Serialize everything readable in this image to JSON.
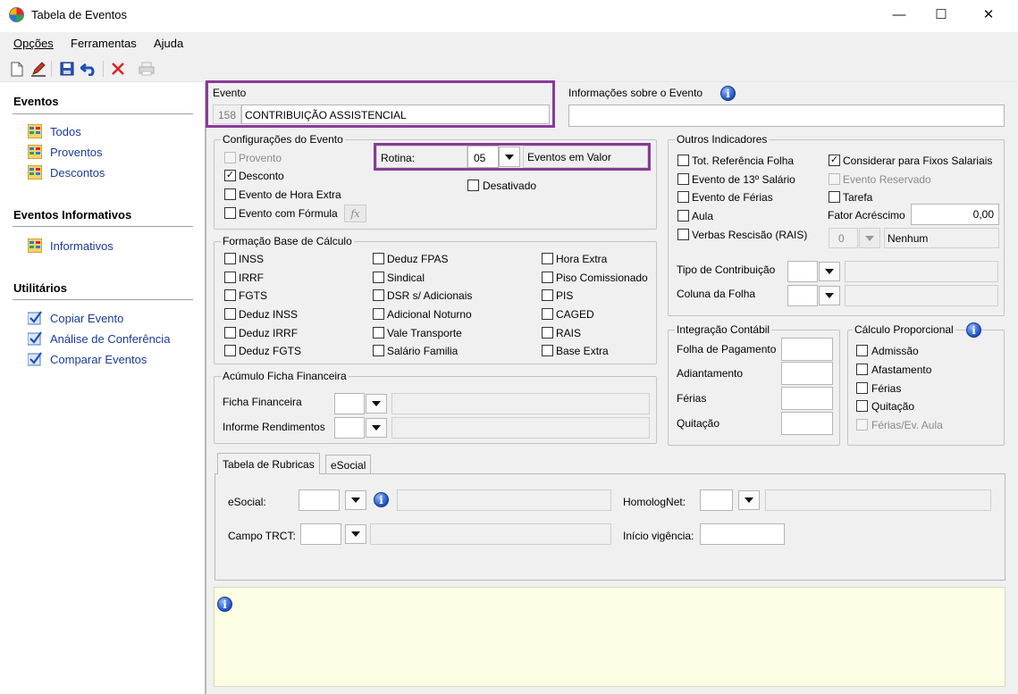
{
  "window": {
    "title": "Tabela de Eventos",
    "minimize": "—",
    "maximize": "☐",
    "close": "✕"
  },
  "menu": [
    "Opções",
    "Ferramentas",
    "Ajuda"
  ],
  "sidebar": {
    "eventos_title": "Eventos",
    "eventos": [
      "Todos",
      "Proventos",
      "Descontos"
    ],
    "informativos_title": "Eventos Informativos",
    "informativos": [
      "Informativos"
    ],
    "utilitarios_title": "Utilitários",
    "utilitarios": [
      "Copiar Evento",
      "Análise de Conferência",
      "Comparar Eventos"
    ]
  },
  "evento": {
    "label": "Evento",
    "code": "158",
    "name": "CONTRIBUIÇÃO ASSISTENCIAL"
  },
  "info_evento": {
    "label": "Informações sobre o Evento",
    "value": ""
  },
  "config": {
    "legend": "Configurações do Evento",
    "provento": "Provento",
    "desconto": "Desconto",
    "hora_extra": "Evento de Hora Extra",
    "formula": "Evento com Fórmula",
    "formula_btn": "fx",
    "rotina_label": "Rotina:",
    "rotina_value": "05",
    "rotina_desc": "Eventos em Valor",
    "desativado": "Desativado"
  },
  "outros": {
    "legend": "Outros Indicadores",
    "tot_ref": "Tot. Referência Folha",
    "decimo": "Evento de 13º Salário",
    "ferias": "Evento de Férias",
    "aula": "Aula",
    "verbas": "Verbas Rescisão (RAIS)",
    "fixos": "Considerar para Fixos Salariais",
    "reservado": "Evento Reservado",
    "tarefa": "Tarefa",
    "fator_label": "Fator Acréscimo",
    "fator_value": "0,00",
    "verbas_code": "0",
    "verbas_desc": "Nenhum",
    "tipo_contrib": "Tipo de Contribuição",
    "coluna_folha": "Coluna da Folha"
  },
  "base": {
    "legend": "Formação Base de Cálculo",
    "col1": [
      "INSS",
      "IRRF",
      "FGTS",
      "Deduz INSS",
      "Deduz IRRF",
      "Deduz FGTS"
    ],
    "col2": [
      "Deduz FPAS",
      "Sindical",
      "DSR s/ Adicionais",
      "Adicional Noturno",
      "Vale Transporte",
      "Salário Familia"
    ],
    "col3": [
      "Hora Extra",
      "Piso Comissionado",
      "PIS",
      "CAGED",
      "RAIS",
      "Base Extra"
    ]
  },
  "acumulo": {
    "legend": "Acúmulo Ficha Financeira",
    "ficha": "Ficha Financeira",
    "informe": "Informe Rendimentos"
  },
  "integracao": {
    "legend": "Integração Contábil",
    "items": [
      "Folha de Pagamento",
      "Adiantamento",
      "Férias",
      "Quitação"
    ]
  },
  "proporcional": {
    "legend": "Cálculo Proporcional",
    "items": [
      "Admissão",
      "Afastamento",
      "Férias",
      "Quitação",
      "Férias/Ev. Aula"
    ]
  },
  "tabs": [
    "Tabela de Rubricas",
    "eSocial"
  ],
  "rubricas": {
    "esocial": "eSocial:",
    "campo_trct": "Campo TRCT:",
    "homolognet": "HomologNet:",
    "inicio": "Início vigência:"
  },
  "colors": {
    "highlight": "#8a3a9a",
    "link": "#1a3a9c",
    "note_bg": "#fdfde3"
  }
}
